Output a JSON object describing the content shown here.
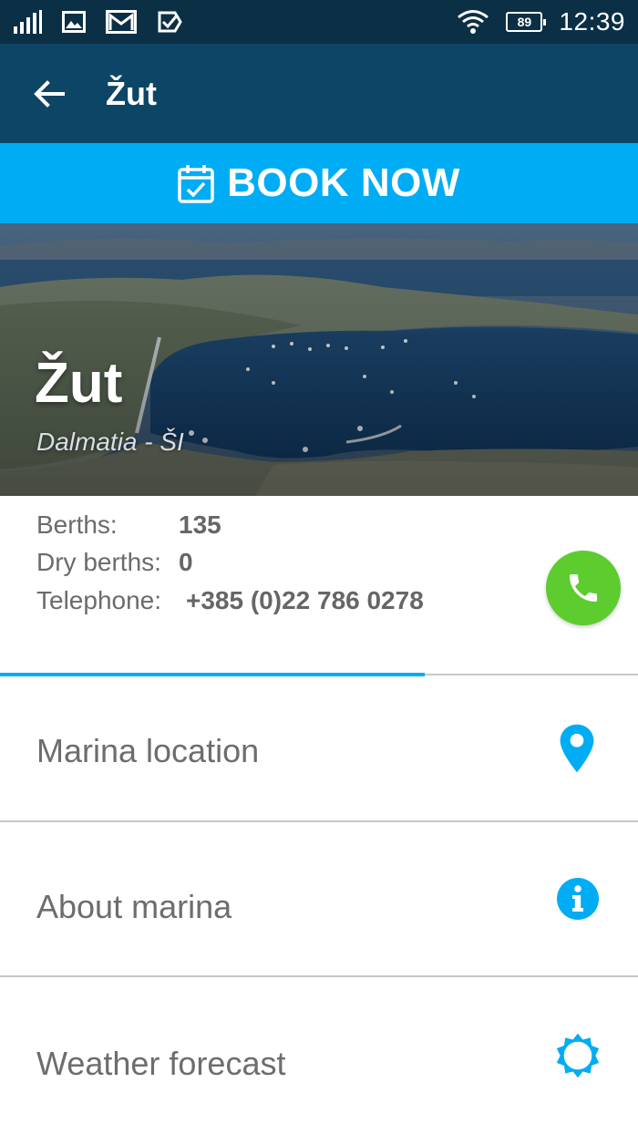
{
  "status_bar": {
    "battery": "89",
    "time": "12:39"
  },
  "app_bar": {
    "title": "Žut"
  },
  "book_now": {
    "label": "BOOK NOW"
  },
  "hero": {
    "title": "Žut",
    "subtitle": "Dalmatia - ŠI"
  },
  "info": {
    "berths_label": "Berths:",
    "berths_value": "135",
    "dry_berths_label": "Dry berths:",
    "dry_berths_value": "0",
    "telephone_label": "Telephone:",
    "telephone_value": "+385 (0)22 786 0278"
  },
  "menu": [
    {
      "label": "Marina location",
      "icon": "location-pin-icon"
    },
    {
      "label": "About marina",
      "icon": "info-icon"
    },
    {
      "label": "Weather forecast",
      "icon": "sun-icon"
    }
  ],
  "colors": {
    "status_bar": "#0b2f45",
    "app_bar": "#0d4566",
    "accent": "#00acf4",
    "call_green": "#5ccc2e"
  }
}
